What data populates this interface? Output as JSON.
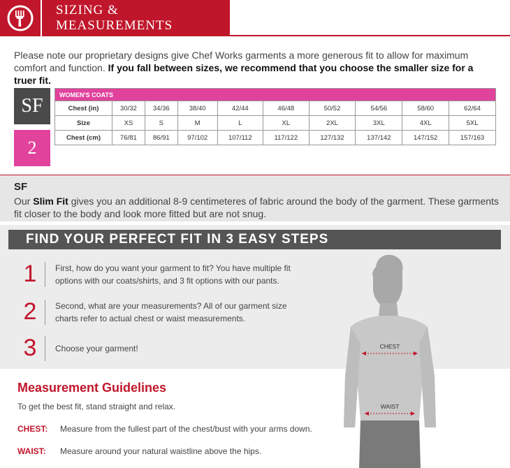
{
  "header": {
    "title": "SIZING & MEASUREMENTS"
  },
  "intro": {
    "text": "Please note our proprietary designs give Chef Works garments a more generous fit to allow for maximum comfort and function.",
    "bold": "If you fall between sizes, we recommend that you choose the smaller size for a truer fit."
  },
  "badges": {
    "sf": "SF",
    "two": "2"
  },
  "table": {
    "heading": "WOMEN'S COATS",
    "rows": [
      {
        "label": "Chest (in)",
        "cells": [
          "30/32",
          "34/36",
          "38/40",
          "42/44",
          "46/48",
          "50/52",
          "54/56",
          "58/60",
          "62/64"
        ]
      },
      {
        "label": "Size",
        "cells": [
          "XS",
          "S",
          "M",
          "L",
          "XL",
          "2XL",
          "3XL",
          "4XL",
          "5XL"
        ]
      },
      {
        "label": "Chest (cm)",
        "cells": [
          "76/81",
          "86/91",
          "97/102",
          "107/112",
          "117/122",
          "127/132",
          "137/142",
          "147/152",
          "157/163"
        ]
      }
    ]
  },
  "slim_fit": {
    "title": "SF",
    "prefix": "Our",
    "bold": "Slim Fit",
    "text": "gives you an additional 8-9 centimeteres of fabric around the body of the garment. These garments fit closer to the body and look more fitted but are not snug."
  },
  "fit_section": {
    "title": "FIND YOUR PERFECT FIT IN 3 EASY STEPS",
    "steps": [
      {
        "num": "1",
        "text": "First, how do you want your garment to fit? You have multiple fit options with our coats/shirts, and 3 fit options with our pants."
      },
      {
        "num": "2",
        "text": "Second, what are your measurements? All of our garment size charts refer to actual chest or waist measurements."
      },
      {
        "num": "3",
        "text": "Choose your garment!"
      }
    ]
  },
  "figure": {
    "chest_label": "CHEST",
    "waist_label": "WAIST"
  },
  "guidelines": {
    "title": "Measurement Guidelines",
    "intro": "To get the best fit, stand straight and relax.",
    "items": [
      {
        "key": "CHEST:",
        "text": "Measure from the fullest part of the chest/bust with your arms down."
      },
      {
        "key": "WAIST:",
        "text": "Measure around your natural waistline above the hips."
      }
    ]
  },
  "colors": {
    "brand_red": "#c0162b",
    "pink": "#e0429c",
    "dark_gray": "#4a4a4a"
  }
}
